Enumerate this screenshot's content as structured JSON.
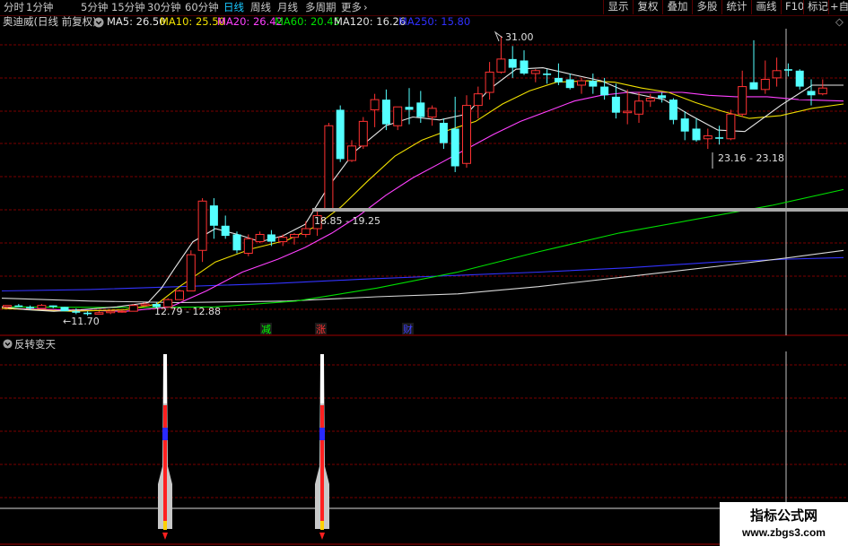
{
  "toolbar": {
    "periods": [
      "分时",
      "1分钟",
      "5分钟",
      "15分钟",
      "30分钟",
      "60分钟",
      "日线",
      "周线",
      "月线",
      "多周期",
      "更多"
    ],
    "active_period": "日线",
    "more_arrow": "›",
    "buttons": [
      "显示",
      "复权",
      "叠加",
      "多股",
      "统计",
      "画线",
      "F10",
      "标记",
      "+自"
    ]
  },
  "info": {
    "stock_name": "奥迪威(日线 前复权)",
    "collapse_icon": "circle-chevron-icon",
    "ma": [
      {
        "label": "MA5: 26.50",
        "color": "#e8e8e8"
      },
      {
        "label": "MA10: 25.50",
        "color": "#f0e000"
      },
      {
        "label": "MA20: 26.42",
        "color": "#ff40ff"
      },
      {
        "label": "MA60: 20.45",
        "color": "#00e000"
      },
      {
        "label": "MA120: 16.26",
        "color": "#e0e0e0"
      },
      {
        "label": "MA250: 15.80",
        "color": "#3030ff"
      }
    ],
    "diamond_icon": "◇"
  },
  "indicator": {
    "title": "反转变天"
  },
  "annotations": {
    "high": "31.00",
    "zone_mid": "18.85 - 19.25",
    "zone_right": "23.16 - 23.18",
    "zone_low": "12.79 - 12.88",
    "low": "11.70"
  },
  "events": [
    {
      "label": "减",
      "color": "#00ff00"
    },
    {
      "label": "涨",
      "color": "#ff3030"
    },
    {
      "label": "财",
      "color": "#4040ff"
    }
  ],
  "watermark": {
    "line1": "指标公式网",
    "line2": "www.zbgs3.com"
  },
  "colors": {
    "up": "#ff3232",
    "down": "#54ffff",
    "grid": "#7a0000",
    "crosshair": "#c0c0c0"
  },
  "chart_data": {
    "type": "candlestick",
    "price_range": [
      11.7,
      31.0
    ],
    "candles": [
      [
        12.3,
        12.4,
        12.2,
        12.4
      ],
      [
        12.4,
        12.5,
        12.3,
        12.3
      ],
      [
        12.3,
        12.4,
        12.1,
        12.2
      ],
      [
        12.2,
        12.5,
        12.2,
        12.4
      ],
      [
        12.4,
        12.4,
        12.2,
        12.3
      ],
      [
        12.3,
        12.3,
        12.0,
        12.0
      ],
      [
        12.0,
        12.2,
        11.8,
        11.9
      ],
      [
        11.9,
        12.0,
        11.7,
        11.8
      ],
      [
        11.8,
        12.0,
        11.8,
        11.9
      ],
      [
        11.9,
        12.1,
        11.8,
        12.0
      ],
      [
        12.0,
        12.1,
        11.9,
        12.0
      ],
      [
        12.0,
        12.5,
        12.0,
        12.4
      ],
      [
        12.4,
        12.6,
        12.3,
        12.5
      ],
      [
        12.5,
        12.6,
        12.2,
        12.3
      ],
      [
        12.3,
        12.9,
        12.3,
        12.8
      ],
      [
        12.8,
        13.5,
        12.8,
        13.4
      ],
      [
        13.4,
        16.2,
        13.4,
        15.9
      ],
      [
        16.2,
        19.8,
        15.4,
        19.6
      ],
      [
        19.3,
        19.8,
        17.0,
        17.9
      ],
      [
        17.9,
        18.6,
        17.0,
        17.2
      ],
      [
        17.3,
        17.5,
        16.0,
        16.2
      ],
      [
        16.0,
        17.3,
        15.8,
        17.0
      ],
      [
        16.8,
        17.5,
        16.7,
        17.3
      ],
      [
        17.3,
        17.6,
        16.5,
        16.8
      ],
      [
        16.8,
        17.3,
        16.5,
        17.1
      ],
      [
        17.1,
        17.4,
        16.6,
        17.3
      ],
      [
        17.3,
        18.2,
        17.1,
        17.7
      ],
      [
        17.7,
        19.0,
        17.2,
        18.6
      ],
      [
        19.0,
        25.0,
        19.0,
        24.8
      ],
      [
        25.9,
        26.2,
        22.3,
        22.5
      ],
      [
        22.4,
        23.8,
        22.3,
        23.4
      ],
      [
        23.4,
        25.4,
        23.2,
        25.1
      ],
      [
        25.9,
        27.0,
        24.7,
        26.6
      ],
      [
        26.6,
        27.3,
        24.5,
        24.9
      ],
      [
        24.8,
        26.1,
        24.5,
        26.1
      ],
      [
        26.1,
        27.4,
        24.9,
        25.9
      ],
      [
        26.4,
        27.2,
        25.0,
        25.4
      ],
      [
        25.4,
        26.2,
        24.8,
        26.0
      ],
      [
        25.0,
        25.3,
        23.2,
        23.6
      ],
      [
        24.6,
        26.8,
        21.6,
        22.0
      ],
      [
        22.2,
        26.9,
        21.9,
        26.2
      ],
      [
        26.2,
        27.5,
        25.3,
        27.0
      ],
      [
        27.1,
        29.2,
        26.6,
        28.5
      ],
      [
        28.5,
        31.0,
        28.4,
        29.4
      ],
      [
        29.4,
        30.3,
        28.1,
        28.8
      ],
      [
        29.3,
        30.0,
        28.3,
        28.4
      ],
      [
        28.4,
        28.7,
        27.8,
        28.6
      ],
      [
        28.4,
        28.7,
        27.7,
        28.3
      ],
      [
        28.1,
        29.1,
        27.6,
        27.8
      ],
      [
        28.0,
        28.4,
        27.3,
        27.4
      ],
      [
        27.6,
        28.1,
        27.0,
        27.9
      ],
      [
        27.9,
        28.4,
        27.0,
        27.5
      ],
      [
        27.5,
        28.1,
        26.6,
        26.9
      ],
      [
        26.8,
        27.7,
        25.3,
        25.7
      ],
      [
        25.7,
        27.3,
        24.9,
        25.8
      ],
      [
        25.6,
        27.1,
        25.0,
        26.5
      ],
      [
        26.5,
        27.0,
        26.1,
        26.7
      ],
      [
        26.9,
        27.1,
        26.4,
        26.7
      ],
      [
        26.6,
        26.7,
        24.9,
        25.2
      ],
      [
        25.3,
        25.8,
        23.8,
        24.4
      ],
      [
        24.6,
        25.3,
        23.7,
        23.8
      ],
      [
        23.9,
        24.6,
        23.2,
        24.1
      ],
      [
        24.0,
        24.8,
        23.5,
        23.9
      ],
      [
        23.9,
        25.9,
        23.8,
        25.6
      ],
      [
        25.6,
        28.6,
        25.4,
        27.5
      ],
      [
        27.8,
        30.7,
        27.7,
        27.3
      ],
      [
        27.3,
        29.3,
        27.0,
        28.0
      ],
      [
        28.1,
        29.5,
        27.5,
        28.6
      ],
      [
        28.7,
        29.1,
        28.2,
        28.6
      ],
      [
        28.6,
        28.7,
        27.3,
        27.5
      ],
      [
        27.2,
        28.0,
        26.2,
        26.9
      ],
      [
        27.0,
        28.0,
        26.9,
        27.4
      ]
    ],
    "ma5": [
      [
        2,
        12.3
      ],
      [
        30,
        12.1
      ],
      [
        60,
        12.0
      ],
      [
        90,
        12.1
      ],
      [
        130,
        12.3
      ],
      [
        165,
        12.6
      ],
      [
        180,
        13.6
      ],
      [
        195,
        15.0
      ],
      [
        215,
        16.8
      ],
      [
        240,
        17.7
      ],
      [
        265,
        17.3
      ],
      [
        290,
        16.8
      ],
      [
        315,
        17.2
      ],
      [
        340,
        18.0
      ],
      [
        365,
        20.5
      ],
      [
        395,
        23.0
      ],
      [
        430,
        24.8
      ],
      [
        460,
        25.4
      ],
      [
        490,
        25.2
      ],
      [
        520,
        25.6
      ],
      [
        545,
        27.3
      ],
      [
        575,
        28.7
      ],
      [
        605,
        28.8
      ],
      [
        640,
        28.3
      ],
      [
        670,
        27.9
      ],
      [
        700,
        27.1
      ],
      [
        740,
        26.6
      ],
      [
        770,
        25.5
      ],
      [
        800,
        24.5
      ],
      [
        830,
        24.4
      ],
      [
        870,
        26.2
      ],
      [
        905,
        27.6
      ],
      [
        940,
        27.6
      ]
    ],
    "ma10": [
      [
        2,
        12.2
      ],
      [
        80,
        12.0
      ],
      [
        140,
        12.1
      ],
      [
        175,
        12.5
      ],
      [
        200,
        13.7
      ],
      [
        240,
        15.4
      ],
      [
        280,
        16.3
      ],
      [
        320,
        16.9
      ],
      [
        350,
        17.8
      ],
      [
        380,
        19.2
      ],
      [
        410,
        21.0
      ],
      [
        440,
        22.7
      ],
      [
        470,
        23.8
      ],
      [
        500,
        24.5
      ],
      [
        530,
        25.1
      ],
      [
        560,
        26.3
      ],
      [
        590,
        27.2
      ],
      [
        620,
        27.8
      ],
      [
        655,
        27.9
      ],
      [
        685,
        27.8
      ],
      [
        715,
        27.4
      ],
      [
        745,
        27.1
      ],
      [
        775,
        26.4
      ],
      [
        805,
        25.8
      ],
      [
        835,
        25.3
      ],
      [
        870,
        25.5
      ],
      [
        905,
        26.0
      ],
      [
        940,
        26.3
      ]
    ],
    "ma20": [
      [
        2,
        12.2
      ],
      [
        140,
        12.0
      ],
      [
        190,
        12.3
      ],
      [
        230,
        13.4
      ],
      [
        270,
        14.7
      ],
      [
        310,
        15.6
      ],
      [
        340,
        16.4
      ],
      [
        370,
        17.4
      ],
      [
        400,
        18.6
      ],
      [
        430,
        20.0
      ],
      [
        460,
        21.2
      ],
      [
        490,
        22.2
      ],
      [
        520,
        23.2
      ],
      [
        550,
        24.2
      ],
      [
        580,
        25.1
      ],
      [
        610,
        25.8
      ],
      [
        640,
        26.5
      ],
      [
        670,
        26.9
      ],
      [
        700,
        27.1
      ],
      [
        730,
        27.1
      ],
      [
        760,
        27.1
      ],
      [
        790,
        26.9
      ],
      [
        820,
        26.8
      ],
      [
        855,
        26.8
      ],
      [
        890,
        26.6
      ],
      [
        940,
        26.5
      ]
    ],
    "ma60": [
      [
        2,
        12.3
      ],
      [
        150,
        12.25
      ],
      [
        240,
        12.3
      ],
      [
        330,
        12.7
      ],
      [
        420,
        13.6
      ],
      [
        510,
        14.7
      ],
      [
        600,
        16.1
      ],
      [
        690,
        17.4
      ],
      [
        780,
        18.4
      ],
      [
        860,
        19.3
      ],
      [
        940,
        20.4
      ]
    ],
    "ma120": [
      [
        2,
        12.9
      ],
      [
        100,
        12.7
      ],
      [
        200,
        12.6
      ],
      [
        320,
        12.7
      ],
      [
        420,
        13.0
      ],
      [
        510,
        13.2
      ],
      [
        600,
        13.7
      ],
      [
        700,
        14.4
      ],
      [
        800,
        15.1
      ],
      [
        880,
        15.7
      ],
      [
        940,
        16.2
      ]
    ],
    "ma250": [
      [
        2,
        13.4
      ],
      [
        100,
        13.5
      ],
      [
        200,
        13.7
      ],
      [
        300,
        13.9
      ],
      [
        400,
        14.2
      ],
      [
        500,
        14.45
      ],
      [
        600,
        14.7
      ],
      [
        700,
        15.0
      ],
      [
        800,
        15.4
      ],
      [
        880,
        15.6
      ],
      [
        940,
        15.7
      ]
    ]
  }
}
